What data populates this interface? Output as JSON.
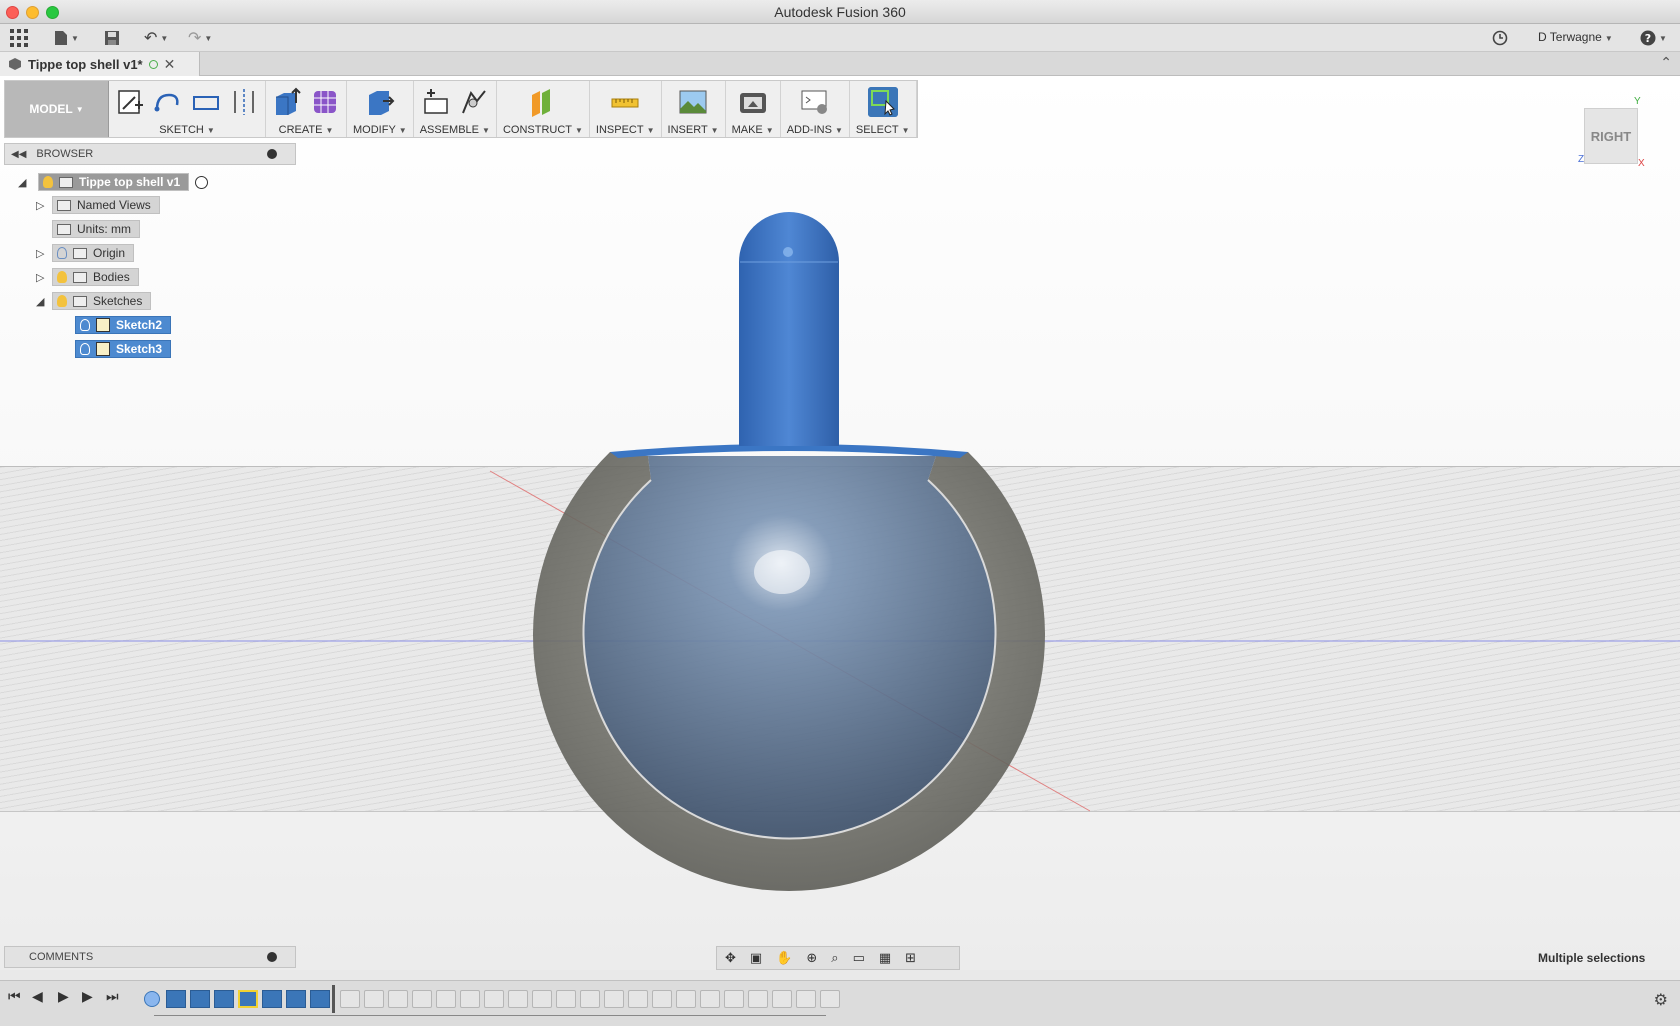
{
  "window": {
    "title": "Autodesk Fusion 360"
  },
  "quick_access": {
    "user": "D Terwagne"
  },
  "document_tab": {
    "name": "Tippe top shell v1*"
  },
  "toolbar": {
    "workspace": "MODEL",
    "groups": [
      "SKETCH",
      "CREATE",
      "MODIFY",
      "ASSEMBLE",
      "CONSTRUCT",
      "INSPECT",
      "INSERT",
      "MAKE",
      "ADD-INS",
      "SELECT"
    ]
  },
  "browser": {
    "title": "BROWSER",
    "root": "Tippe top shell v1",
    "items": [
      "Named Views",
      "Units: mm",
      "Origin",
      "Bodies",
      "Sketches"
    ],
    "sketches": [
      "Sketch2",
      "Sketch3"
    ]
  },
  "viewcube": {
    "face": "RIGHT",
    "axes": {
      "y": "Y",
      "z": "Z",
      "x": "X"
    }
  },
  "comments": {
    "title": "COMMENTS"
  },
  "status": {
    "text": "Multiple selections"
  },
  "colors": {
    "model_blue": "#3b76c4",
    "shell_grey": "#7b7b74",
    "selection_blue": "#4d8ad0",
    "accent_green": "#28c840"
  }
}
